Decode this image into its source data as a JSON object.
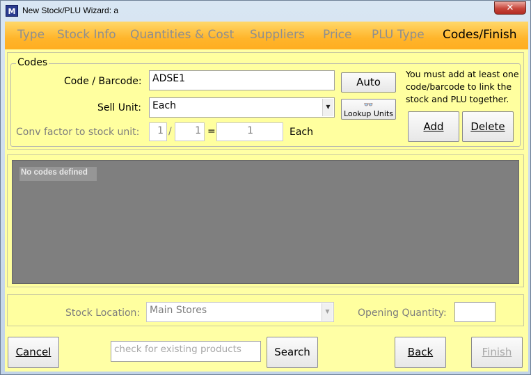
{
  "window": {
    "title": "New Stock/PLU Wizard: a",
    "icon": "app-logo-icon",
    "close_glyph": "✕"
  },
  "tabs": [
    {
      "label": "Type",
      "active": false
    },
    {
      "label": "Stock Info",
      "active": false
    },
    {
      "label": "Quantities & Cost",
      "active": false
    },
    {
      "label": "Suppliers",
      "active": false
    },
    {
      "label": "Price",
      "active": false
    },
    {
      "label": "PLU Type",
      "active": false
    },
    {
      "label": "Codes/Finish",
      "active": true
    }
  ],
  "codes": {
    "group_label": "Codes",
    "code_label": "Code / Barcode:",
    "code_value": "ADSE1",
    "sell_unit_label": "Sell Unit:",
    "sell_unit_value": "Each",
    "conv_label": "Conv factor to stock unit:",
    "conv_num": "1",
    "conv_sep": "/",
    "conv_den": "1",
    "conv_eq": "=",
    "conv_result": "1",
    "conv_unit": "Each",
    "auto_button": "Auto",
    "lookup_button": "Lookup Units",
    "lookup_icon": "glasses-icon",
    "hint": "You must add at least one code/barcode to link the stock and PLU together.",
    "add_button": "Add",
    "delete_button": "Delete"
  },
  "code_list": {
    "empty_text": "No codes defined"
  },
  "location": {
    "stock_location_label": "Stock Location:",
    "stock_location_value": "Main Stores",
    "opening_qty_label": "Opening Quantity:",
    "opening_qty_value": ""
  },
  "footer": {
    "cancel_button": "Cancel",
    "search_placeholder": "check for existing products",
    "search_button": "Search",
    "back_button": "Back",
    "finish_button": "Finish"
  },
  "colors": {
    "tab_bar": "#ffb52b",
    "panel_bg": "#ffffa5",
    "list_bg": "#7f7f7f",
    "inactive_text": "#8f8f8f",
    "close_button": "#c7453a"
  }
}
